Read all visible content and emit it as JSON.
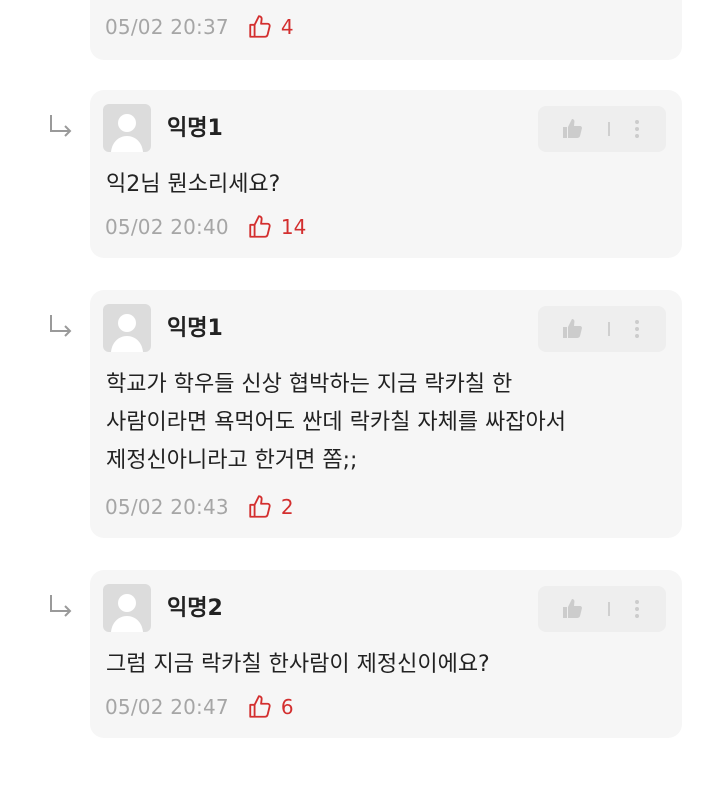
{
  "comments": [
    {
      "timestamp": "05/02 20:37",
      "likes": "4"
    },
    {
      "author": "익명1",
      "lines": [
        "익2님 뭔소리세요?"
      ],
      "timestamp": "05/02 20:40",
      "likes": "14"
    },
    {
      "author": "익명1",
      "lines": [
        "학교가 학우들 신상 협박하는 지금 락카칠 한",
        "사람이라면 욕먹어도 싼데 락카칠 자체를 싸잡아서",
        "제정신아니라고 한거면 쫌;;"
      ],
      "timestamp": "05/02 20:43",
      "likes": "2"
    },
    {
      "author": "익명2",
      "lines": [
        "그럼 지금 락카칠 한사람이 제정신이에요?"
      ],
      "timestamp": "05/02 20:47",
      "likes": "6"
    }
  ],
  "colors": {
    "card_bg": "#f6f6f6",
    "like_red": "#d32f2f",
    "meta_gray": "#a6a6a6",
    "text": "#222222"
  },
  "icons": {
    "reply": "reply-arrow-icon",
    "avatar": "default-avatar-icon",
    "like": "thumbs-up-icon",
    "more": "more-vertical-icon"
  }
}
